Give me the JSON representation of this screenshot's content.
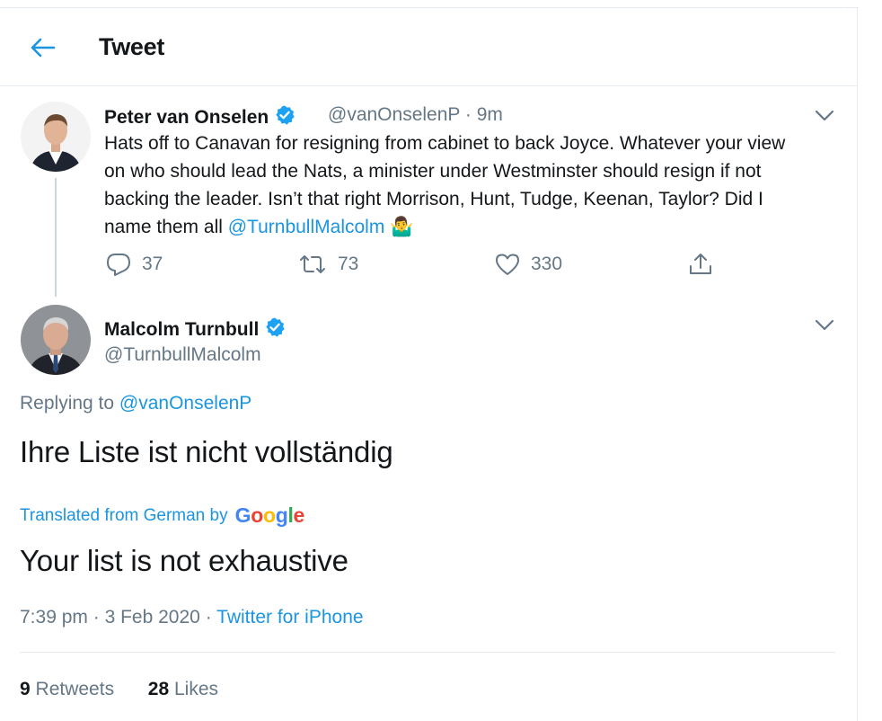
{
  "header": {
    "title": "Tweet"
  },
  "quoted": {
    "name": "Peter van Onselen",
    "handle": "@vanOnselenP",
    "sep": "·",
    "time": "9m",
    "text_before": "Hats off to Canavan for resigning from cabinet to back Joyce. Whatever your view on who should lead the Nats, a minister under Westminster should resign if not backing the leader. Isn’t that right Morrison, Hunt, Tudge, Keenan, Taylor? Did I name them all ",
    "mention": "@TurnbullMalcolm",
    "emoji": "🤷‍♂️",
    "replies": "37",
    "retweets": "73",
    "likes": "330"
  },
  "main": {
    "name": "Malcolm Turnbull",
    "handle": "@TurnbullMalcolm",
    "replying_label": "Replying to ",
    "replying_to": "@vanOnselenP",
    "original_text": "Ihre Liste ist nicht vollständig",
    "translated_label": "Translated from German by",
    "google": [
      "G",
      "o",
      "o",
      "g",
      "l",
      "e"
    ],
    "translation": "Your list is not exhaustive",
    "time": "7:39 pm",
    "date": "3 Feb 2020",
    "dot": "·",
    "source": "Twitter for iPhone",
    "retweet_count": "9",
    "retweet_label": "Retweets",
    "like_count": "28",
    "like_label": "Likes"
  },
  "colors": {
    "accent": "#1b95e0",
    "secondary": "#657786",
    "border": "#e6ecf0"
  }
}
